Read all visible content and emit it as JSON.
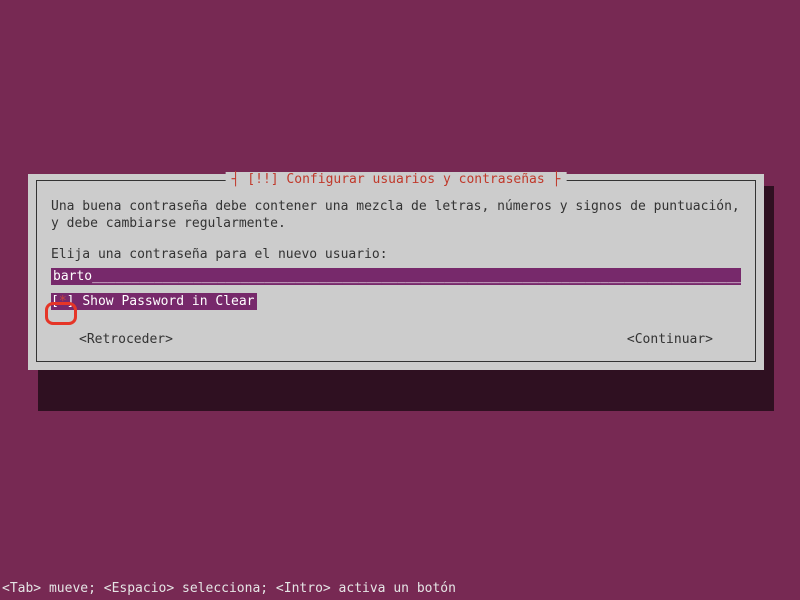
{
  "dialog": {
    "title_prefix": "[!!]",
    "title": "Configurar usuarios y contraseñas",
    "description": "Una buena contraseña debe contener una mezcla de letras, números y signos de puntuación, y debe cambiarse regularmente.",
    "prompt": "Elija una contraseña para el nuevo usuario:",
    "password_value": "barto",
    "checkbox": {
      "checked_glyph": "*",
      "label": "Show Password in Clear"
    },
    "buttons": {
      "back": "<Retroceder>",
      "continue": "<Continuar>"
    }
  },
  "footer": {
    "hint": "<Tab> mueve; <Espacio> selecciona; <Intro> activa un botón"
  }
}
